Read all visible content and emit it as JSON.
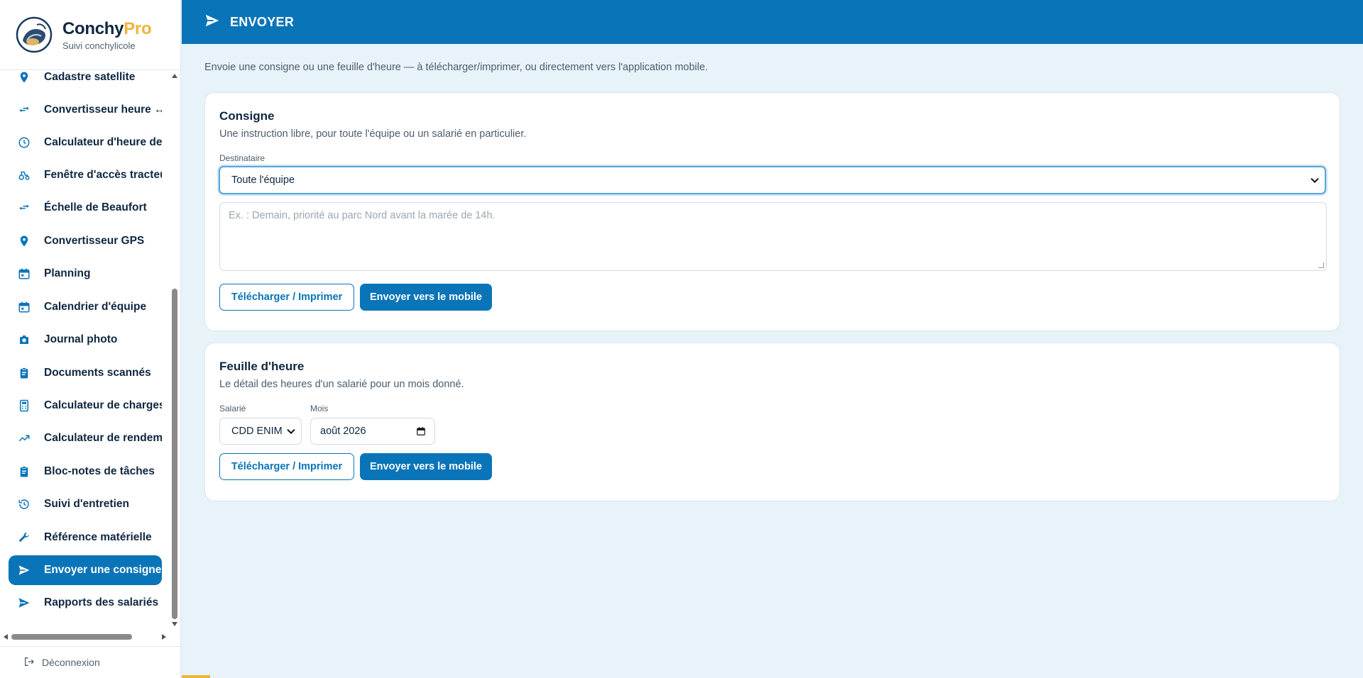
{
  "brand": {
    "name": "Conchy",
    "name_accent": "Pro",
    "subtitle": "Suivi conchylicole",
    "accent_color": "#f0b43a"
  },
  "sidebar": {
    "items": [
      {
        "label": "Cadastre satellite",
        "icon": "map-pin-icon"
      },
      {
        "label": "Convertisseur heure ↔ hauteur",
        "icon": "swap-arrows-icon"
      },
      {
        "label": "Calculateur d'heure de départ",
        "icon": "clock-icon"
      },
      {
        "label": "Fenêtre d'accès tracteur",
        "icon": "tractor-icon"
      },
      {
        "label": "Échelle de Beaufort",
        "icon": "swap-arrows-icon"
      },
      {
        "label": "Convertisseur GPS",
        "icon": "map-pin-icon"
      },
      {
        "label": "Planning",
        "icon": "calendar-icon"
      },
      {
        "label": "Calendrier d'équipe",
        "icon": "calendar-icon"
      },
      {
        "label": "Journal photo",
        "icon": "camera-icon"
      },
      {
        "label": "Documents scannés",
        "icon": "clipboard-icon"
      },
      {
        "label": "Calculateur de charges",
        "icon": "calculator-icon"
      },
      {
        "label": "Calculateur de rendement",
        "icon": "trend-up-icon"
      },
      {
        "label": "Bloc-notes de tâches",
        "icon": "clipboard-icon"
      },
      {
        "label": "Suivi d'entretien",
        "icon": "history-icon"
      },
      {
        "label": "Référence matérielle",
        "icon": "wrench-icon"
      },
      {
        "label": "Envoyer une consigne",
        "icon": "send-icon",
        "active": true
      },
      {
        "label": "Rapports des salariés",
        "icon": "send-icon"
      }
    ],
    "logout_label": "Déconnexion"
  },
  "header": {
    "title": "ENVOYER",
    "color": "#0a74b8"
  },
  "main": {
    "intro": "Envoie une consigne ou une feuille d'heure — à télécharger/imprimer, ou directement vers l'application mobile.",
    "consigne": {
      "title": "Consigne",
      "description": "Une instruction libre, pour toute l'équipe ou un salarié en particulier.",
      "recipient_label": "Destinataire",
      "recipient_value": "Toute l'équipe",
      "message_placeholder": "Ex. : Demain, priorité au parc Nord avant la marée de 14h.",
      "download_label": "Télécharger / Imprimer",
      "send_label": "Envoyer vers le mobile"
    },
    "timesheet": {
      "title": "Feuille d'heure",
      "description": "Le détail des heures d'un salarié pour un mois donné.",
      "employee_label": "Salarié",
      "employee_value": "CDD ENIM",
      "month_label": "Mois",
      "month_value": "août 2026",
      "download_label": "Télécharger / Imprimer",
      "send_label": "Envoyer vers le mobile"
    }
  }
}
